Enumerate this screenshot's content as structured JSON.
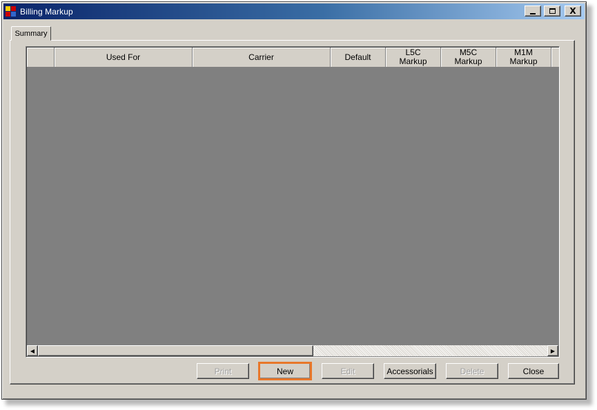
{
  "window": {
    "title": "Billing Markup",
    "icon": "app-window-icon",
    "controls": [
      "minimize-icon",
      "maximize-icon",
      "close-icon"
    ],
    "close_glyph": "X"
  },
  "tabs": [
    {
      "label": "Summary",
      "active": true
    }
  ],
  "grid": {
    "columns": [
      {
        "label": ""
      },
      {
        "label": "Used For"
      },
      {
        "label": "Carrier"
      },
      {
        "label": "Default"
      },
      {
        "label": "L5C\nMarkup"
      },
      {
        "label": "M5C\nMarkup"
      },
      {
        "label": "M1M\nMarkup"
      },
      {
        "label": ""
      }
    ],
    "rows": [],
    "scroll_left_glyph": "◀",
    "scroll_right_glyph": "▶"
  },
  "buttons": {
    "print": {
      "label": "Print",
      "enabled": false
    },
    "new": {
      "label": "New",
      "enabled": true,
      "highlighted": true
    },
    "edit": {
      "label": "Edit",
      "enabled": false
    },
    "accessorials": {
      "label": "Accessorials",
      "enabled": true
    },
    "delete": {
      "label": "Delete",
      "enabled": false
    },
    "close": {
      "label": "Close",
      "enabled": true
    }
  },
  "colors": {
    "title_gradient_start": "#0a246a",
    "title_gradient_end": "#a6caf0",
    "face": "#d4d0c8",
    "grid_background": "#808080",
    "highlight": "#e8772a"
  }
}
